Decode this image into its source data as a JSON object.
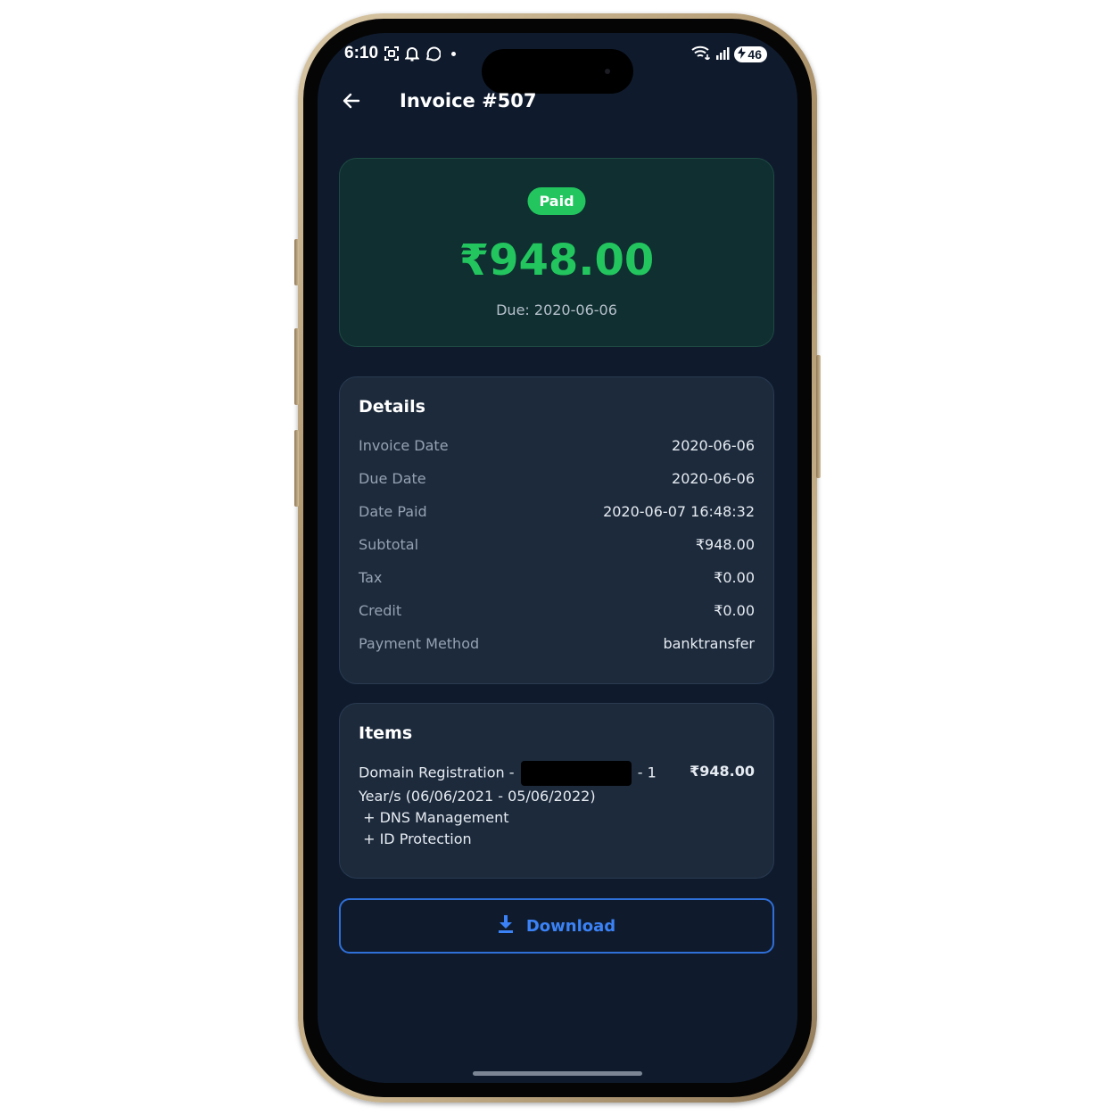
{
  "status_bar": {
    "time": "6:10",
    "left_icons": [
      "screenshot-icon",
      "bell-icon",
      "whatsapp-icon"
    ],
    "right_icons": [
      "wifi-icon",
      "signal-icon"
    ],
    "battery_level": "46"
  },
  "header": {
    "title": "Invoice #507"
  },
  "summary": {
    "status": "Paid",
    "amount": "₹948.00",
    "due": "Due: 2020-06-06"
  },
  "details": {
    "title": "Details",
    "rows": [
      {
        "label": "Invoice Date",
        "value": "2020-06-06"
      },
      {
        "label": "Due Date",
        "value": "2020-06-06"
      },
      {
        "label": "Date Paid",
        "value": "2020-06-07 16:48:32"
      },
      {
        "label": "Subtotal",
        "value": "₹948.00"
      },
      {
        "label": "Tax",
        "value": "₹0.00"
      },
      {
        "label": "Credit",
        "value": "₹0.00"
      },
      {
        "label": "Payment Method",
        "value": "banktransfer"
      }
    ]
  },
  "items": {
    "title": "Items",
    "list": [
      {
        "line1_prefix": "Domain Registration -",
        "line1_suffix": "- 1",
        "line2": "Year/s (06/06/2021 - 05/06/2022)",
        "line3": " + DNS Management",
        "line4": " + ID Protection",
        "amount": "₹948.00"
      }
    ]
  },
  "actions": {
    "download_label": "Download"
  },
  "colors": {
    "background": "#0f1b2d",
    "card": "#1c2a3c",
    "summary_card": "#0f2f30",
    "success": "#22c55e",
    "accent": "#3b82f6"
  }
}
